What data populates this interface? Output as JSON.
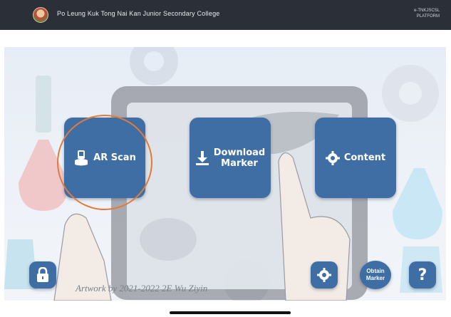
{
  "header": {
    "school_name": "Po Leung Kuk Tong Nai Kan Junior Secondary College",
    "app_code_line1": "e-TNKJSCSL",
    "app_code_line2": "PLATFORM"
  },
  "main": {
    "ar_scan_label": "AR Scan",
    "download_line1": "Download",
    "download_line2": "Marker",
    "content_label": "Content"
  },
  "bottom": {
    "obtain_line1": "Obtain",
    "obtain_line2": "Marker"
  },
  "artwork_credit": "Artwork by 2021-2022 2E Wu Ziyin",
  "colors": {
    "topbar": "#2b2f38",
    "button": "#3f6ea5",
    "highlight_ring": "#e07b3c"
  },
  "icons": [
    "school-logo",
    "phone-scan-icon",
    "download-icon",
    "gear-icon",
    "lock-icon",
    "question-icon"
  ]
}
